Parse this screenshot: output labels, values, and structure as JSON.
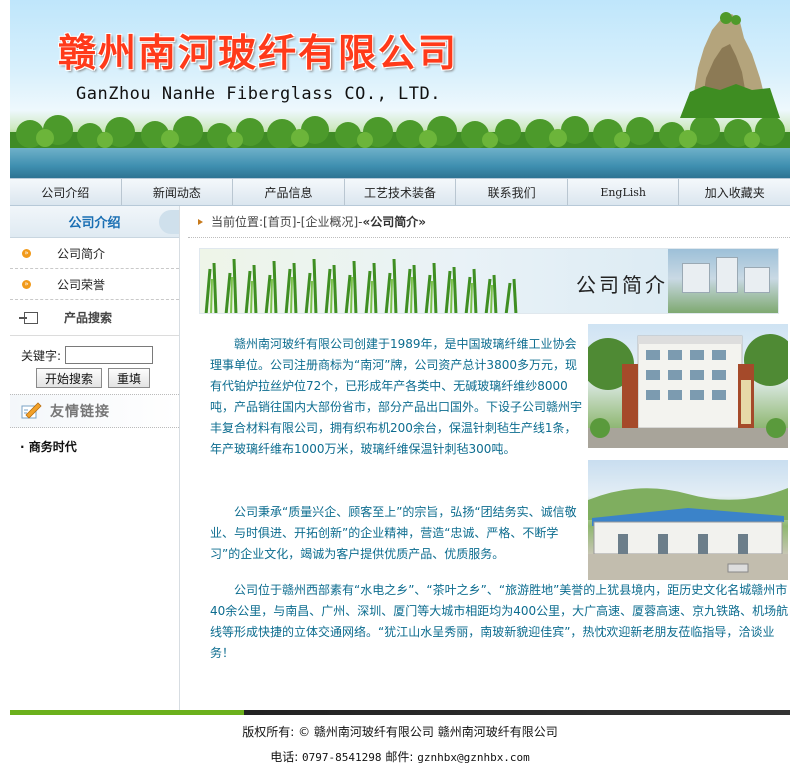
{
  "header": {
    "title_cn": "赣州南河玻纤有限公司",
    "title_en": "GanZhou NanHe Fiberglass CO., LTD."
  },
  "nav": {
    "items": [
      {
        "label": "公司介绍"
      },
      {
        "label": "新闻动态"
      },
      {
        "label": "产品信息"
      },
      {
        "label": "工艺技术装备"
      },
      {
        "label": "联系我们"
      },
      {
        "label": "EngLish"
      },
      {
        "label": "加入收藏夹"
      }
    ]
  },
  "sidebar": {
    "title": "公司介绍",
    "items": [
      {
        "label": "公司简介"
      },
      {
        "label": "公司荣誉"
      }
    ],
    "search": {
      "title": "产品搜索",
      "keyword_label": "关键字:",
      "keyword_value": "",
      "submit_label": "开始搜索",
      "reset_label": "重填"
    },
    "links": {
      "title": "友情链接",
      "items": [
        {
          "label": "· 商务时代"
        }
      ]
    }
  },
  "breadcrumb": {
    "prefix": "当前位置: ",
    "home": "[首页]",
    "sep1": " - ",
    "section": "[企业概况]",
    "sep2": " - ",
    "current": "«公司简介»"
  },
  "main": {
    "banner_title": "公司简介",
    "paragraphs": [
      "赣州南河玻纤有限公司创建于1989年，是中国玻璃纤维工业协会理事单位。公司注册商标为“南河”牌，公司资产总计3800多万元，现有代铂炉拉丝炉位72个，已形成年产各类中、无碱玻璃纤维纱8000吨，产品销往国内大部份省市，部分产品出口国外。下设子公司赣州宇丰复合材料有限公司，拥有织布机200余台，保温针刺毡生产线1条，年产玻璃纤维布1000万米，玻璃纤维保温针刺毡300吨。",
      "公司秉承“质量兴企、顾客至上”的宗旨，弘扬“团结务实、诚信敬业、与时俱进、开拓创新”的企业精神，营造“忠诚、严格、不断学习”的企业文化，竭诚为客户提供优质产品、优质服务。",
      "公司位于赣州西部素有“水电之乡”、“茶叶之乡”、“旅游胜地”美誉的上犹县境内，距历史文化名城赣州市40余公里，与南昌、广州、深圳、厦门等大城市相距均为400公里，大广高速、厦蓉高速、京九铁路、机场航线等形成快捷的立体交通网络。“犹江山水呈秀丽，南玻新貌迎佳宾”，热忱欢迎新老朋友莅临指导，洽谈业务！"
    ]
  },
  "footer": {
    "copyright": "版权所有: © 赣州南河玻纤有限公司 赣州南河玻纤有限公司",
    "phone_label": "电话: ",
    "phone": "0797-8541298",
    "email_label": " 邮件: ",
    "email": "gznhbx@gznhbx.com"
  }
}
